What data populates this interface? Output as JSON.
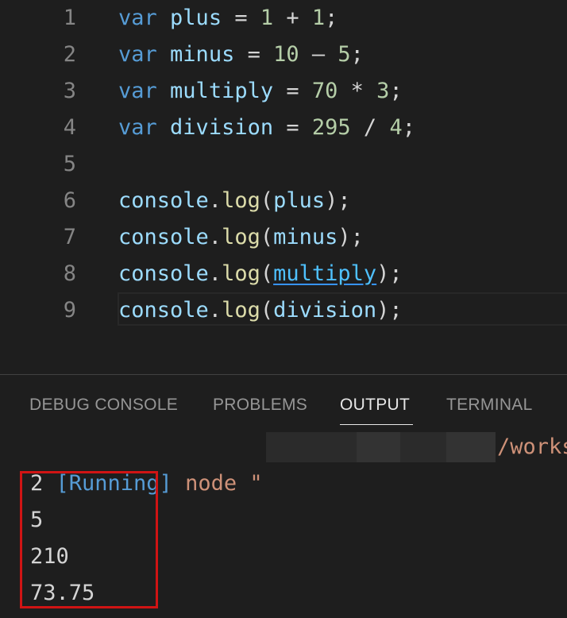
{
  "editor": {
    "lines": [
      {
        "number": "1",
        "tokens": [
          {
            "cls": "kw",
            "text": "var"
          },
          {
            "cls": "op",
            "text": " "
          },
          {
            "cls": "var",
            "text": "plus"
          },
          {
            "cls": "op",
            "text": " = "
          },
          {
            "cls": "num",
            "text": "1"
          },
          {
            "cls": "op",
            "text": " + "
          },
          {
            "cls": "num",
            "text": "1"
          },
          {
            "cls": "op",
            "text": ";"
          }
        ]
      },
      {
        "number": "2",
        "tokens": [
          {
            "cls": "kw",
            "text": "var"
          },
          {
            "cls": "op",
            "text": " "
          },
          {
            "cls": "var",
            "text": "minus"
          },
          {
            "cls": "op",
            "text": " = "
          },
          {
            "cls": "num",
            "text": "10"
          },
          {
            "cls": "op",
            "text": " – "
          },
          {
            "cls": "num",
            "text": "5"
          },
          {
            "cls": "op",
            "text": ";"
          }
        ]
      },
      {
        "number": "3",
        "tokens": [
          {
            "cls": "kw",
            "text": "var"
          },
          {
            "cls": "op",
            "text": " "
          },
          {
            "cls": "var",
            "text": "multiply"
          },
          {
            "cls": "op",
            "text": " = "
          },
          {
            "cls": "num",
            "text": "70"
          },
          {
            "cls": "op",
            "text": " * "
          },
          {
            "cls": "num",
            "text": "3"
          },
          {
            "cls": "op",
            "text": ";"
          }
        ]
      },
      {
        "number": "4",
        "tokens": [
          {
            "cls": "kw",
            "text": "var"
          },
          {
            "cls": "op",
            "text": " "
          },
          {
            "cls": "var",
            "text": "division"
          },
          {
            "cls": "op",
            "text": " = "
          },
          {
            "cls": "num",
            "text": "295"
          },
          {
            "cls": "op",
            "text": " / "
          },
          {
            "cls": "num",
            "text": "4"
          },
          {
            "cls": "op",
            "text": ";"
          }
        ]
      },
      {
        "number": "5",
        "tokens": []
      },
      {
        "number": "6",
        "tokens": [
          {
            "cls": "var",
            "text": "console"
          },
          {
            "cls": "op",
            "text": "."
          },
          {
            "cls": "fn",
            "text": "log"
          },
          {
            "cls": "op",
            "text": "("
          },
          {
            "cls": "var",
            "text": "plus"
          },
          {
            "cls": "op",
            "text": ");"
          }
        ]
      },
      {
        "number": "7",
        "tokens": [
          {
            "cls": "var",
            "text": "console"
          },
          {
            "cls": "op",
            "text": "."
          },
          {
            "cls": "fn",
            "text": "log"
          },
          {
            "cls": "op",
            "text": "("
          },
          {
            "cls": "var",
            "text": "minus"
          },
          {
            "cls": "op",
            "text": ");"
          }
        ]
      },
      {
        "number": "8",
        "tokens": [
          {
            "cls": "var",
            "text": "console"
          },
          {
            "cls": "op",
            "text": "."
          },
          {
            "cls": "fn",
            "text": "log"
          },
          {
            "cls": "op",
            "text": "("
          },
          {
            "cls": "link-u",
            "text": "multiply"
          },
          {
            "cls": "op",
            "text": ");"
          }
        ]
      },
      {
        "number": "9",
        "tokens": [
          {
            "cls": "var",
            "text": "console"
          },
          {
            "cls": "op",
            "text": "."
          },
          {
            "cls": "fn",
            "text": "log"
          },
          {
            "cls": "op",
            "text": "("
          },
          {
            "cls": "var",
            "text": "division"
          },
          {
            "cls": "op",
            "text": ");"
          }
        ]
      }
    ]
  },
  "panel": {
    "tabs": {
      "debug_console": "DEBUG CONSOLE",
      "problems": "PROBLEMS",
      "output": "OUTPUT",
      "terminal": "TERMINAL"
    },
    "active_tab": "OUTPUT",
    "output": {
      "running_tag": "[Running]",
      "running_cmd": " node \"",
      "running_tail": "/works",
      "results": [
        "2",
        "5",
        "210",
        "73.75"
      ]
    }
  },
  "colors": {
    "background": "#1e1e1e",
    "keyword": "#569cd6",
    "variable": "#9cdcfe",
    "number": "#b5cea8",
    "function": "#dcdcaa",
    "string": "#ce9178",
    "highlight_box": "#d01414"
  }
}
